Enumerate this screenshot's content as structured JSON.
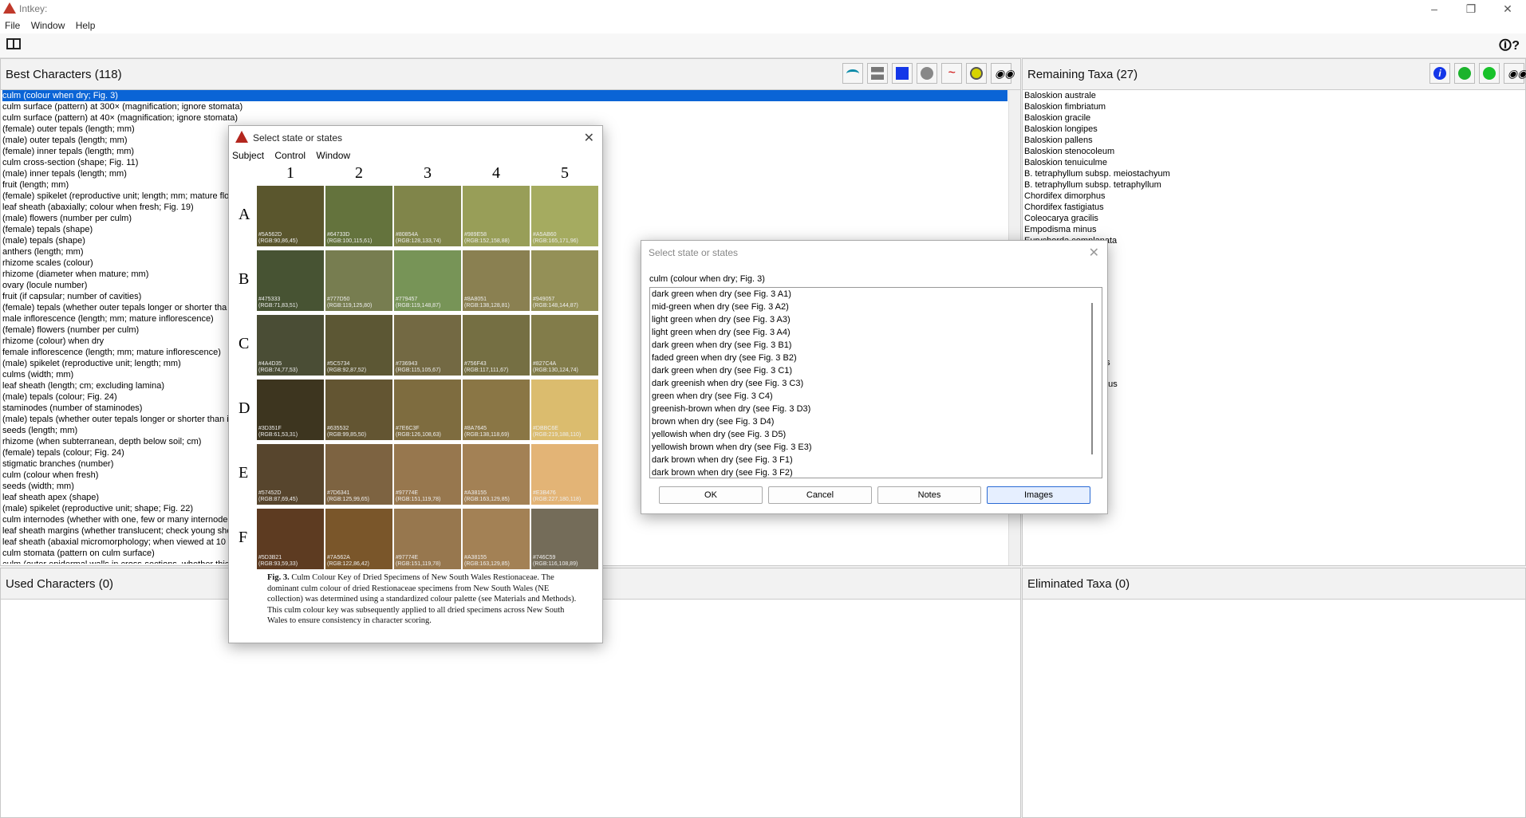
{
  "window": {
    "title": "Intkey:"
  },
  "menu": {
    "file": "File",
    "window": "Window",
    "help": "Help"
  },
  "best_characters": {
    "title": "Best Characters (118)",
    "items": [
      "culm (colour when dry; Fig. 3)",
      "culm surface (pattern) at 300× (magnification; ignore stomata)",
      "culm surface (pattern) at 40× (magnification; ignore stomata)",
      "(female) outer tepals (length; mm)",
      "(male) outer tepals (length; mm)",
      "(female) inner tepals (length; mm)",
      "culm cross-section (shape; Fig. 11)",
      "(male) inner tepals (length; mm)",
      "fruit (length; mm)",
      "(female) spikelet (reproductive unit; length; mm; mature flo",
      "leaf sheath (abaxially; colour when fresh; Fig. 19)",
      "(male) flowers (number per culm)",
      "(female) tepals (shape)",
      "(male) tepals (shape)",
      "anthers (length; mm)",
      "rhizome scales (colour)",
      "rhizome (diameter when mature; mm)",
      "ovary (locule number)",
      "fruit (if capsular; number of cavities)",
      "(female) tepals (whether outer tepals longer or shorter tha",
      "male inflorescence (length; mm; mature inflorescence)",
      "(female) flowers (number per culm)",
      "rhizome (colour) when dry",
      "female inflorescence (length; mm; mature inflorescence)",
      "(male) spikelet (reproductive unit; length; mm)",
      "culms (width; mm)",
      "leaf sheath (length; cm; excluding lamina)",
      "(male) tepals (colour; Fig. 24)",
      "staminodes (number of staminodes)",
      "(male) tepals (whether outer tepals longer or shorter than i",
      "seeds (length; mm)",
      "rhizome (when subterranean, depth below soil; cm)",
      "(female) tepals (colour; Fig. 24)",
      "stigmatic branches (number)",
      "culm (colour when fresh)",
      "seeds (width; mm)",
      "leaf sheath apex (shape)",
      "(male) spikelet (reproductive unit; shape; Fig. 22)",
      "culm internodes (whether with one, few or many internode",
      "leaf sheath margins (whether translucent; check young she",
      "leaf sheath (abaxial micromorphology; when viewed at 10 :",
      "culm stomata (pattern on culm surface)",
      "culm (outer epidermal walls in cross-sections, whether thick"
    ]
  },
  "remaining_taxa": {
    "title": "Remaining Taxa (27)",
    "items": [
      "Baloskion australe",
      "Baloskion fimbriatum",
      "Baloskion gracile",
      "Baloskion longipes",
      "Baloskion pallens",
      "Baloskion stenocoleum",
      "Baloskion tenuiculme",
      "B. tetraphyllum subsp. meiostachyum",
      "B. tetraphyllum subsp. tetraphyllum",
      "Chordifex dimorphus",
      "Chordifex fastigiatus",
      "Coleocarya gracilis",
      "Empodisma minus",
      "Eurychorda complanata"
    ],
    "fragments": [
      "us",
      "otus"
    ]
  },
  "used_characters": {
    "title": "Used Characters (0)"
  },
  "eliminated_taxa": {
    "title": "Eliminated Taxa (0)"
  },
  "image_dialog": {
    "title": "Select state or states",
    "menu": [
      "Subject",
      "Control",
      "Window"
    ],
    "columns": [
      "1",
      "2",
      "3",
      "4",
      "5"
    ],
    "rows": [
      {
        "letter": "A",
        "cells": [
          {
            "hex": "#5A562D",
            "rgb": "(RGB:90,86,45)"
          },
          {
            "hex": "#64733D",
            "rgb": "(RGB:100,115,61)"
          },
          {
            "hex": "#80854A",
            "rgb": "(RGB:128,133,74)"
          },
          {
            "hex": "#989E58",
            "rgb": "(RGB:152,158,88)"
          },
          {
            "hex": "#A5AB60",
            "rgb": "(RGB:165,171,96)"
          }
        ]
      },
      {
        "letter": "B",
        "cells": [
          {
            "hex": "#475333",
            "rgb": "(RGB:71,83,51)"
          },
          {
            "hex": "#777D50",
            "rgb": "(RGB:119,125,80)"
          },
          {
            "hex": "#779457",
            "rgb": "(RGB:119,148,87)"
          },
          {
            "hex": "#8A8051",
            "rgb": "(RGB:138,128,81)"
          },
          {
            "hex": "#949057",
            "rgb": "(RGB:148,144,87)"
          }
        ]
      },
      {
        "letter": "C",
        "cells": [
          {
            "hex": "#4A4D35",
            "rgb": "(RGB:74,77,53)"
          },
          {
            "hex": "#5C5734",
            "rgb": "(RGB:92,87,52)"
          },
          {
            "hex": "#736943",
            "rgb": "(RGB:115,105,67)"
          },
          {
            "hex": "#756F43",
            "rgb": "(RGB:117,111,67)"
          },
          {
            "hex": "#827C4A",
            "rgb": "(RGB:130,124,74)"
          }
        ]
      },
      {
        "letter": "D",
        "cells": [
          {
            "hex": "#3D351F",
            "rgb": "(RGB:61,53,31)"
          },
          {
            "hex": "#635532",
            "rgb": "(RGB:99,85,50)"
          },
          {
            "hex": "#7E6C3F",
            "rgb": "(RGB:126,108,63)"
          },
          {
            "hex": "#8A7645",
            "rgb": "(RGB:138,118,69)"
          },
          {
            "hex": "#DBBC6E",
            "rgb": "(RGB:219,188,110)"
          }
        ]
      },
      {
        "letter": "E",
        "cells": [
          {
            "hex": "#57452D",
            "rgb": "(RGB:87,69,45)"
          },
          {
            "hex": "#7D6341",
            "rgb": "(RGB:125,99,65)"
          },
          {
            "hex": "#97774E",
            "rgb": "(RGB:151,119,78)"
          },
          {
            "hex": "#A38155",
            "rgb": "(RGB:163,129,85)"
          },
          {
            "hex": "#E3B476",
            "rgb": "(RGB:227,180,118)"
          }
        ]
      },
      {
        "letter": "F",
        "cells": [
          {
            "hex": "#5D3B21",
            "rgb": "(RGB:93,59,33)"
          },
          {
            "hex": "#7A562A",
            "rgb": "(RGB:122,86,42)"
          },
          {
            "hex": "#97774E",
            "rgb": "(RGB:151,119,78)"
          },
          {
            "hex": "#A38155",
            "rgb": "(RGB:163,129,85)"
          },
          {
            "hex": "#746C59",
            "rgb": "(RGB:116,108,89)"
          }
        ]
      }
    ],
    "caption_bold": "Fig. 3.",
    "caption_text": " Culm Colour Key of Dried Specimens of New South Wales Restionaceae. The dominant culm colour of dried Restionaceae specimens from New South Wales (NE collection) was determined using a standardized colour palette (see Materials and Methods). This culm colour key was subsequently applied to all dried specimens across New South Wales to ensure consistency in character scoring."
  },
  "state_dialog": {
    "title": "Select state or states",
    "character": "culm (colour when dry; Fig. 3)",
    "states": [
      "dark green when dry (see Fig. 3 A1)",
      "mid-green when dry (see Fig. 3 A2)",
      "light green when dry (see Fig. 3 A3)",
      "light green when dry (see Fig. 3 A4)",
      "dark green when dry (see Fig. 3 B1)",
      "faded green when dry (see Fig. 3 B2)",
      "dark green when dry (see Fig. 3 C1)",
      "dark greenish when dry (see Fig. 3 C3)",
      "green when dry (see Fig. 3 C4)",
      "greenish-brown when dry (see Fig. 3 D3)",
      "brown when dry (see Fig. 3 D4)",
      "yellowish when dry (see Fig. 3 D5)",
      "yellowish brown when dry (see Fig. 3 E3)",
      "dark brown when dry (see Fig. 3 F1)",
      "dark brown when dry (see Fig. 3 F2)"
    ],
    "buttons": {
      "ok": "OK",
      "cancel": "Cancel",
      "notes": "Notes",
      "images": "Images"
    }
  }
}
